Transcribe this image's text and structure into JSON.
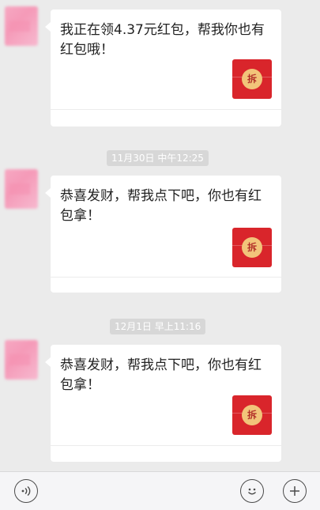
{
  "messages": [
    {
      "text": "我正在领4.37元红包，帮我你也有红包哦！",
      "packet_seal": "拆"
    },
    {
      "text": "恭喜发财，帮我点下吧，你也有红包拿！",
      "packet_seal": "拆"
    },
    {
      "text": "恭喜发财，帮我点下吧，你也有红包拿！",
      "packet_seal": "拆"
    }
  ],
  "timestamps": [
    "11月30日 中午12:25",
    "12月1日 早上11:16"
  ],
  "input_bar": {
    "voice_icon": "voice-icon",
    "emoji_icon": "emoji-icon",
    "plus_icon": "plus-icon"
  },
  "colors": {
    "background": "#ebebeb",
    "bubble": "#ffffff",
    "red_packet": "#d9252b",
    "seal": "#f2c47a"
  }
}
